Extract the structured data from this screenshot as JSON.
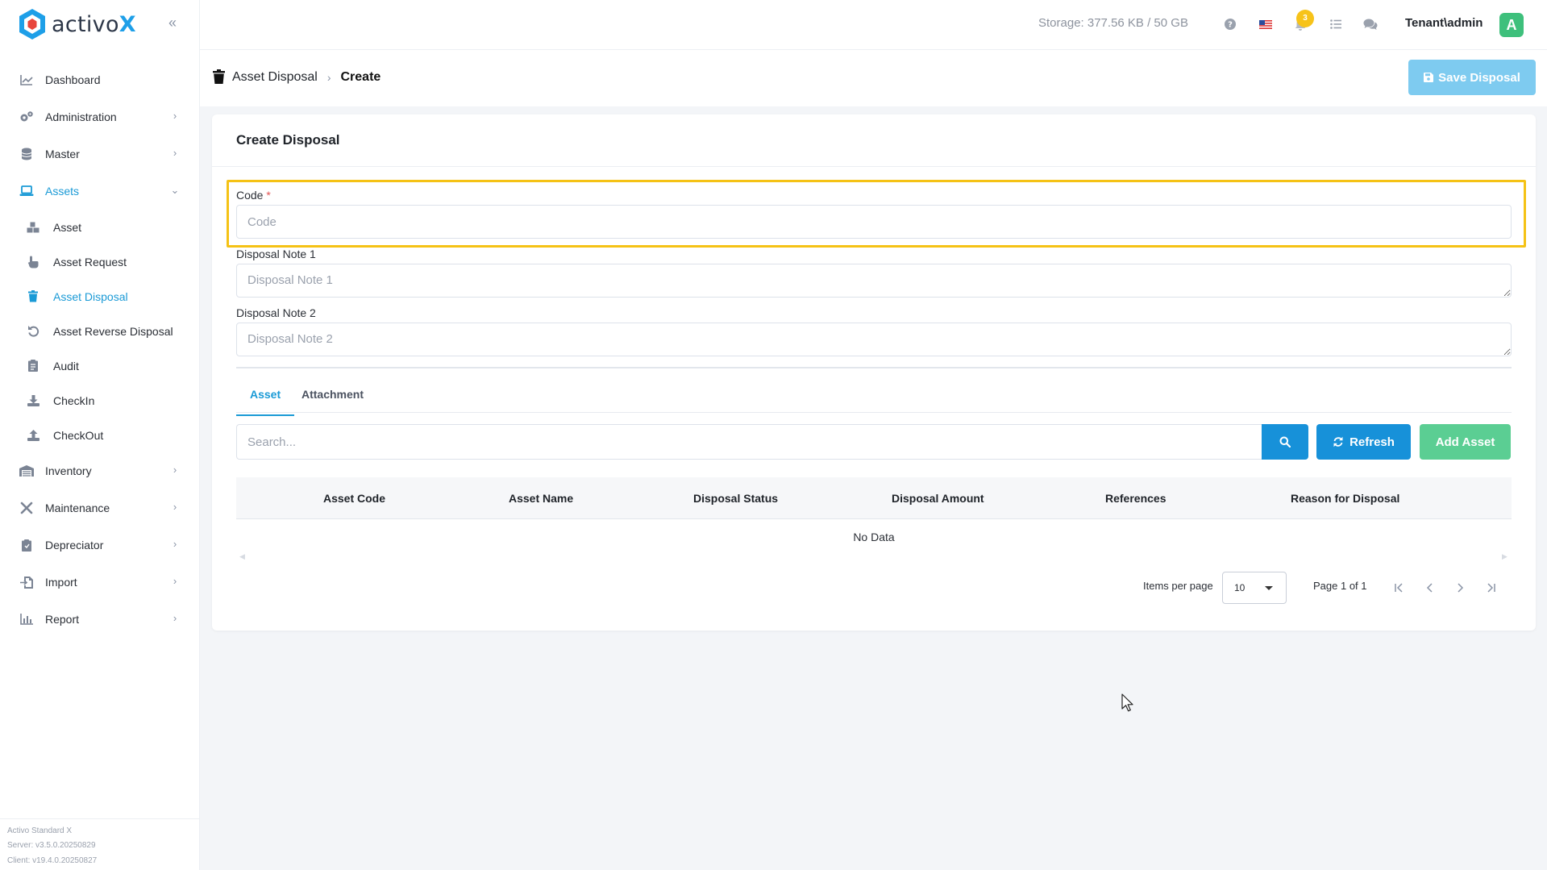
{
  "app": {
    "logo_text": "activo",
    "logo_accent": "X",
    "brand_color": "#1e9fe8",
    "accent_color": "#1a9ad6"
  },
  "sidebar": {
    "items": [
      {
        "label": "Dashboard",
        "icon": "chart-line-icon"
      },
      {
        "label": "Administration",
        "icon": "gears-icon"
      },
      {
        "label": "Master",
        "icon": "database-icon"
      },
      {
        "label": "Assets",
        "icon": "laptop-icon"
      },
      {
        "label": "Inventory",
        "icon": "warehouse-icon"
      },
      {
        "label": "Maintenance",
        "icon": "tools-icon"
      },
      {
        "label": "Depreciator",
        "icon": "clipboard-icon"
      },
      {
        "label": "Import",
        "icon": "file-import-icon"
      },
      {
        "label": "Report",
        "icon": "bar-chart-icon"
      }
    ],
    "asset_subitems": [
      {
        "label": "Asset",
        "icon": "boxes-icon"
      },
      {
        "label": "Asset Request",
        "icon": "hand-pointer-icon"
      },
      {
        "label": "Asset Disposal",
        "icon": "trash-icon"
      },
      {
        "label": "Asset Reverse Disposal",
        "icon": "undo-icon"
      },
      {
        "label": "Audit",
        "icon": "clipboard-list-icon"
      },
      {
        "label": "CheckIn",
        "icon": "download-icon"
      },
      {
        "label": "CheckOut",
        "icon": "upload-icon"
      }
    ],
    "version": {
      "product": "Activo Standard X",
      "server": "Server: v3.5.0.20250829",
      "client": "Client: v19.4.0.20250827"
    }
  },
  "topbar": {
    "storage": "Storage: 377.56 KB / 50 GB",
    "notification_count": "3",
    "user": "Tenant\\admin",
    "avatar_letter": "A"
  },
  "header": {
    "breadcrumb_section": "Asset Disposal",
    "breadcrumb_current": "Create",
    "save_label": "Save Disposal"
  },
  "form": {
    "title": "Create Disposal",
    "code_label": "Code",
    "code_required_mark": "*",
    "code_placeholder": "Code",
    "note1_label": "Disposal Note 1",
    "note1_placeholder": "Disposal Note 1",
    "note2_label": "Disposal Note 2",
    "note2_placeholder": "Disposal Note 2"
  },
  "tabs": [
    {
      "label": "Asset",
      "active": true
    },
    {
      "label": "Attachment",
      "active": false
    }
  ],
  "toolbar": {
    "search_placeholder": "Search...",
    "refresh_label": "Refresh",
    "add_label": "Add Asset"
  },
  "table": {
    "columns": [
      "Asset Code",
      "Asset Name",
      "Disposal Status",
      "Disposal Amount",
      "References",
      "Reason for Disposal"
    ],
    "empty_text": "No Data"
  },
  "pagination": {
    "items_per_page_label": "Items per page",
    "items_per_page_value": "10",
    "page_info": "Page 1 of 1"
  }
}
